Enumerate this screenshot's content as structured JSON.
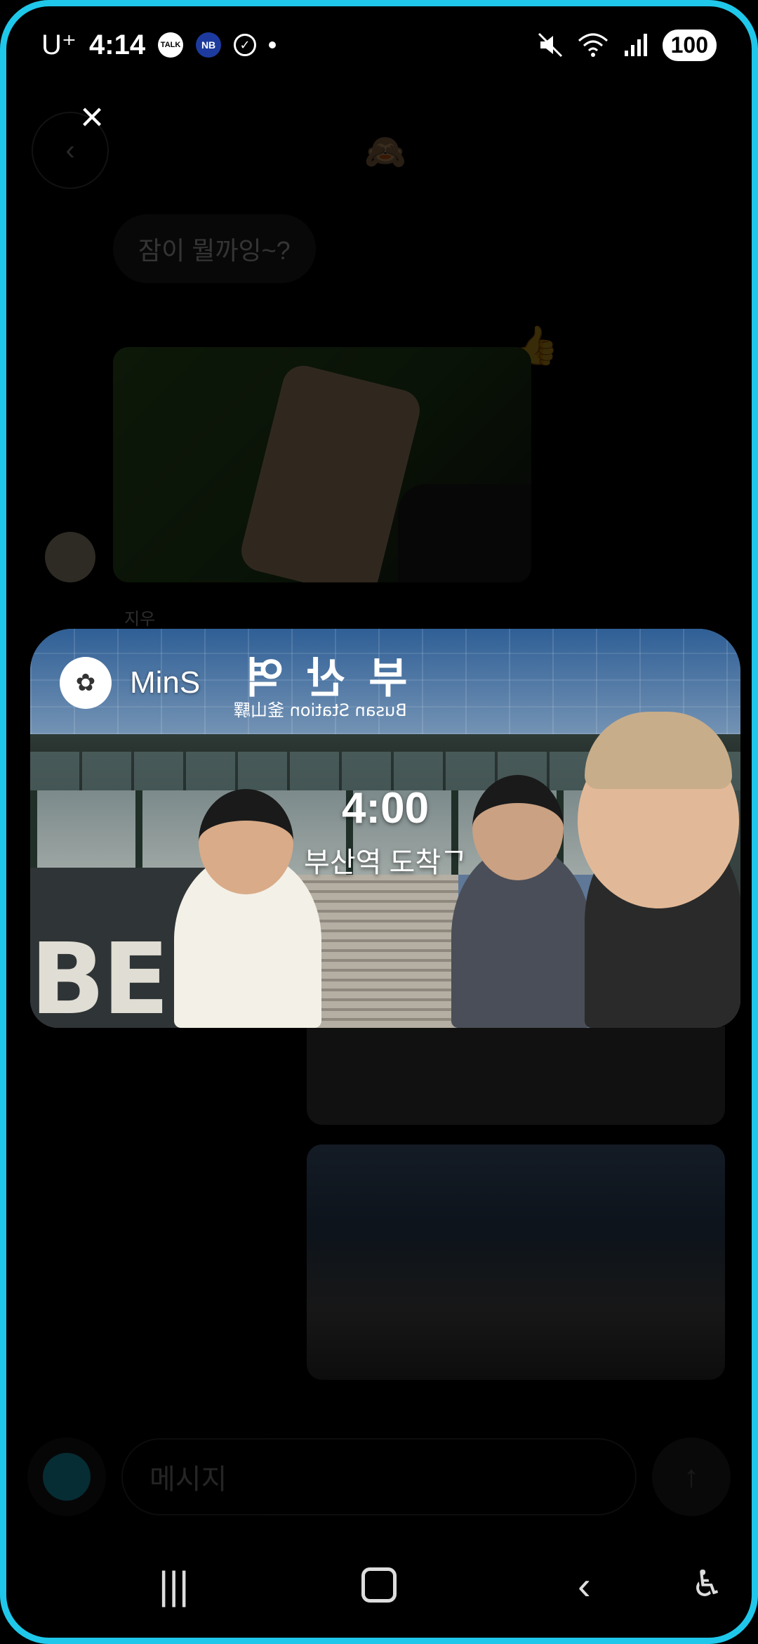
{
  "status_bar": {
    "carrier": "U⁺",
    "time": "4:14",
    "notification_icons": [
      "talk-icon",
      "nb-icon",
      "check-circle-icon",
      "dot-icon"
    ],
    "talk_label": "TALK",
    "nb_label": "NB",
    "status_icons": [
      "mute-icon",
      "wifi-icon",
      "signal-icon"
    ],
    "battery": "100"
  },
  "viewer": {
    "close_icon": "×"
  },
  "chat_background": {
    "back_icon": "‹",
    "top_emoji": "🙈",
    "bubble_text": "잠이 뭘까잉~?",
    "reaction_emoji": "👍",
    "sender_name": "지우"
  },
  "featured_post": {
    "poster_name": "MinS",
    "time": "4:00",
    "caption": "부산역 도착ᄀ",
    "sign_main": "부 산 역",
    "sign_sub": "Busan Station 釜山驛",
    "building_letters": "BE"
  },
  "composer": {
    "placeholder": "메시지",
    "send_icon": "↑"
  },
  "nav_bar": {
    "recents_icon": "|||",
    "back_icon": "‹",
    "accessibility_icon": "♿"
  },
  "colors": {
    "accent": "#1fc8ea",
    "background": "#000000"
  }
}
